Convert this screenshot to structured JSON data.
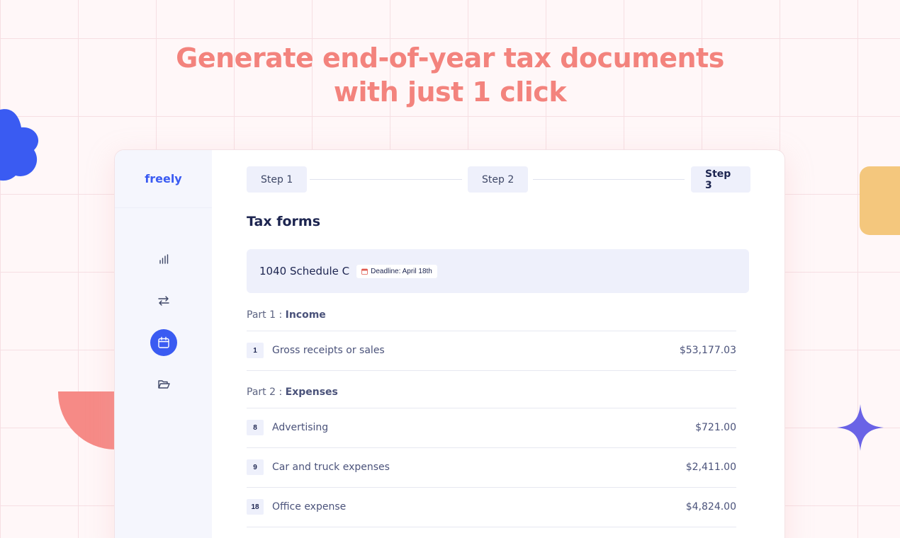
{
  "headline": {
    "line1": "Generate end-of-year tax documents",
    "line2": "with just 1 click"
  },
  "colors": {
    "headline": "#f3837d",
    "brand": "#3a5bf2",
    "blob": "#3a5bf2",
    "quarter_circle": "#f68a86",
    "yellow_tab": "#f4c77d",
    "sparkle": "#6a63e6"
  },
  "sidebar": {
    "brand": "freely",
    "items": [
      {
        "icon": "bar-chart-icon",
        "active": false
      },
      {
        "icon": "transfer-arrows-icon",
        "active": false
      },
      {
        "icon": "calendar-icon",
        "active": true
      },
      {
        "icon": "folder-icon",
        "active": false
      }
    ]
  },
  "steps": [
    "Step 1",
    "Step 2",
    "Step 3"
  ],
  "current_step": "Step 3",
  "main": {
    "title": "Tax forms",
    "form": {
      "name": "1040 Schedule C",
      "deadline": "Deadline: April 18th"
    },
    "parts": [
      {
        "prefix": "Part 1 :",
        "name": "Income",
        "rows": [
          {
            "line": "1",
            "label": "Gross receipts or sales",
            "amount": "$53,177.03"
          }
        ]
      },
      {
        "prefix": "Part 2 :",
        "name": "Expenses",
        "rows": [
          {
            "line": "8",
            "label": "Advertising",
            "amount": "$721.00"
          },
          {
            "line": "9",
            "label": "Car and truck expenses",
            "amount": "$2,411.00"
          },
          {
            "line": "18",
            "label": "Office expense",
            "amount": "$4,824.00"
          }
        ]
      }
    ]
  }
}
